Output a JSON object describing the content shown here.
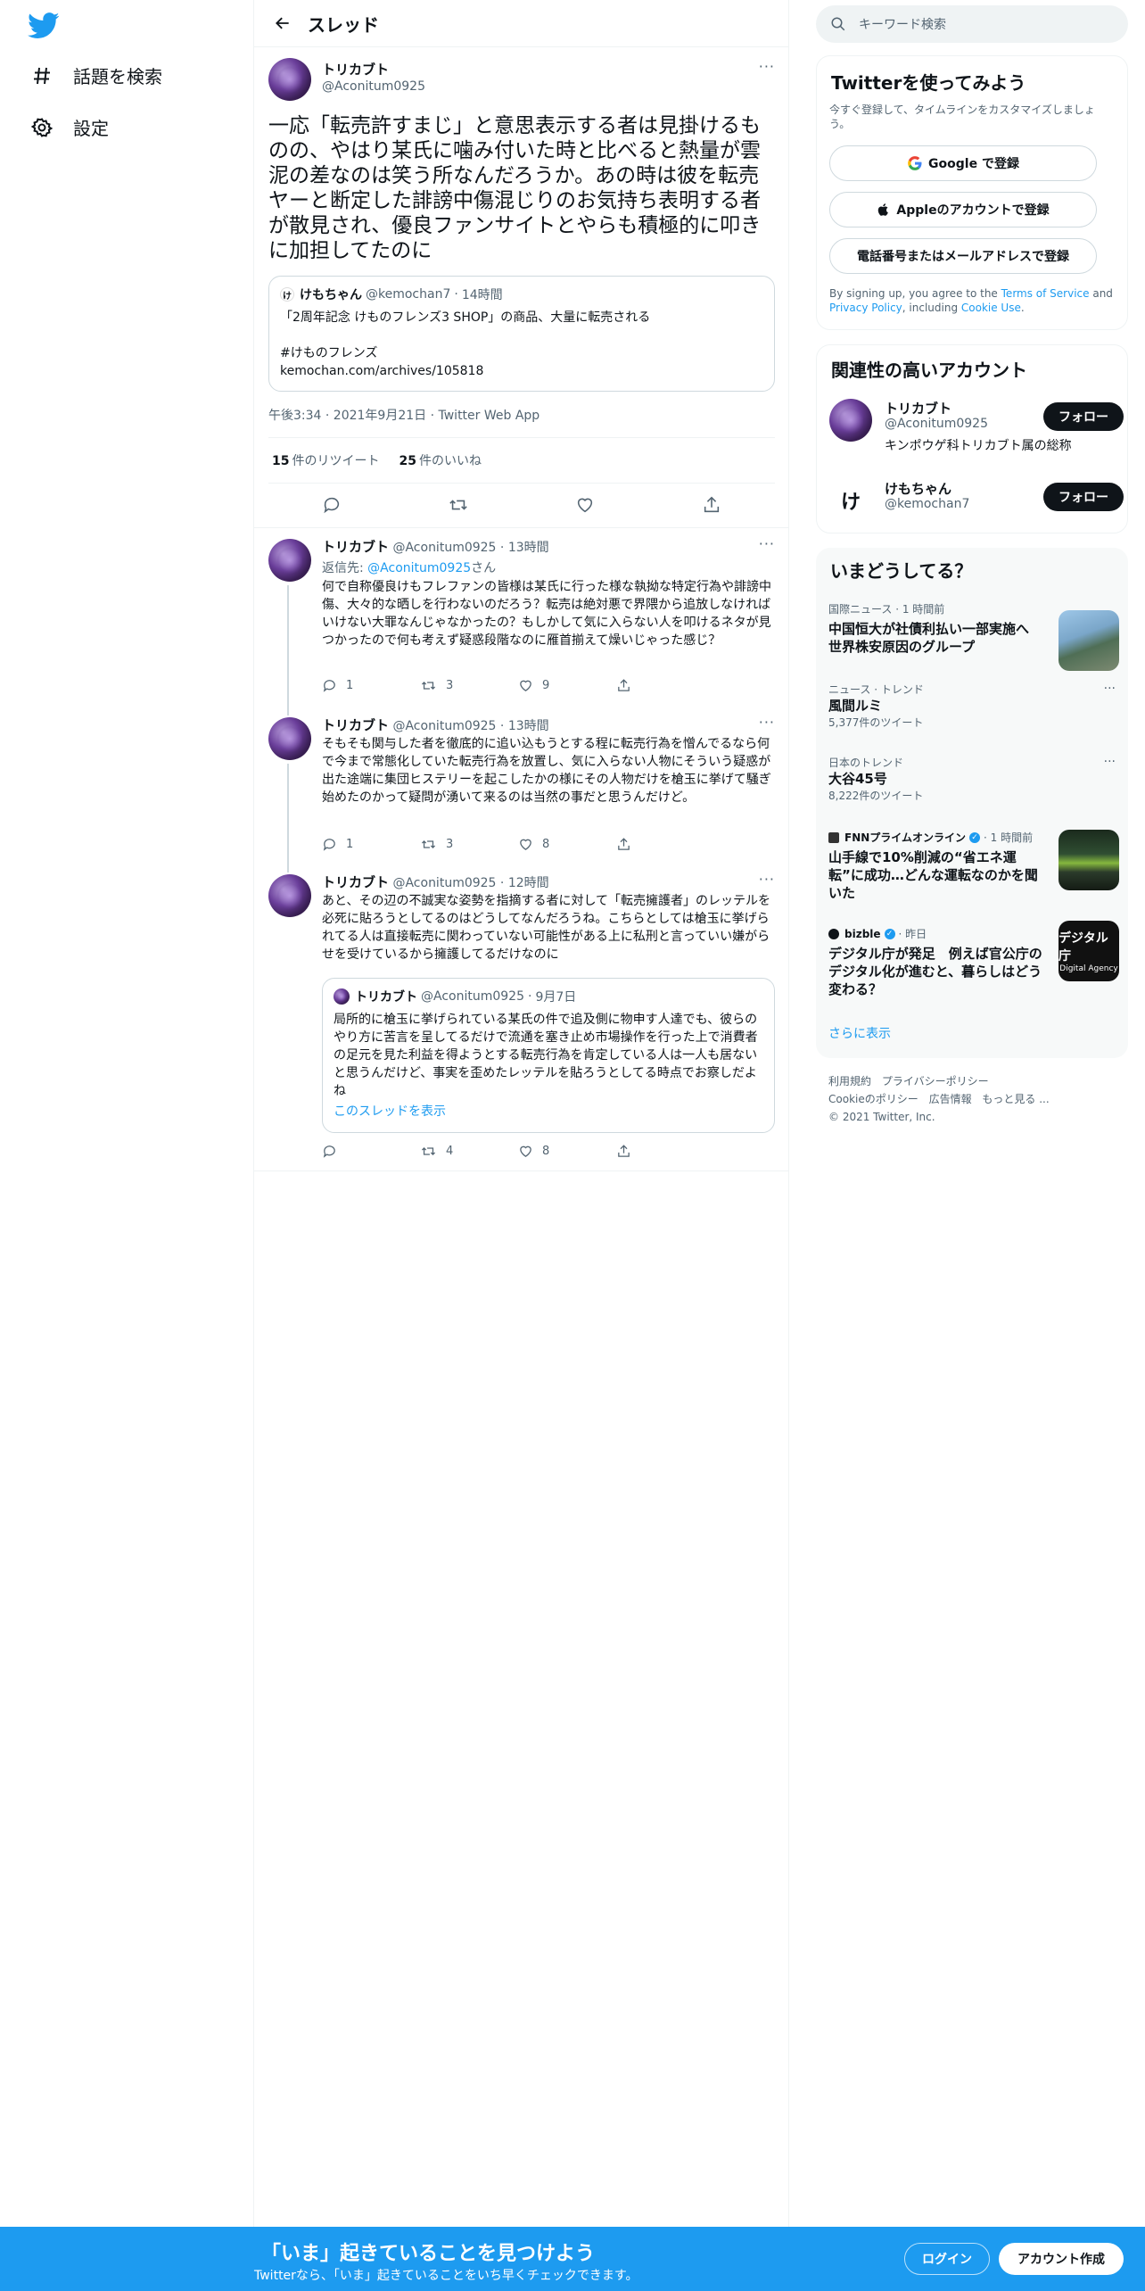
{
  "nav": {
    "explore_label": "話題を検索",
    "settings_label": "設定"
  },
  "header": {
    "title": "スレッド"
  },
  "main_tweet": {
    "author_name": "トリカブト",
    "author_handle": "@Aconitum0925",
    "more": "···",
    "text": "一応「転売許すまじ」と意思表示する者は見掛けるものの、やはり某氏に噛み付いた時と比べると熱量が雲泥の差なのは笑う所なんだろうか。あの時は彼を転売ヤーと断定した誹謗中傷混じりのお気持ち表明する者が散見され、優良ファンサイトとやらも積極的に叩きに加担してたのに",
    "quote": {
      "avatar_letter": "け",
      "name": "けもちゃん",
      "handle": "@kemochan7",
      "time": "14時間",
      "text": "「2周年記念 けものフレンズ3 SHOP」の商品、大量に転売される\n\n#けものフレンズ\nkemochan.com/archives/105818"
    },
    "timestamp": "午後3:34 · 2021年9月21日 · Twitter Web App",
    "retweets_count": "15",
    "retweets_label": "件のリツイート",
    "likes_count": "25",
    "likes_label": "件のいいね"
  },
  "replies": [
    {
      "name": "トリカブト",
      "handle": "@Aconitum0925",
      "time": "13時間",
      "reply_to_prefix": "返信先: ",
      "reply_to_handle": "@Aconitum0925",
      "reply_to_suffix": "さん",
      "text": "何で自称優良けもフレファンの皆様は某氏に行った様な執拗な特定行為や誹謗中傷、大々的な晒しを行わないのだろう？転売は絶対悪で界隈から追放しなければいけない大罪なんじゃなかったの？もしかして気に入らない人を叩けるネタが見つかったので何も考えず疑惑段階なのに雁首揃えて燥いじゃった感じ？",
      "replies": "1",
      "retweets": "3",
      "likes": "9"
    },
    {
      "name": "トリカブト",
      "handle": "@Aconitum0925",
      "time": "13時間",
      "text": "そもそも関与した者を徹底的に追い込もうとする程に転売行為を憎んでるなら何で今まで常態化していた転売行為を放置し、気に入らない人物にそういう疑惑が出た途端に集団ヒステリーを起こしたかの様にその人物だけを槍玉に挙げて騒ぎ始めたのかって疑問が湧いて来るのは当然の事だと思うんだけど。",
      "replies": "1",
      "retweets": "3",
      "likes": "8"
    },
    {
      "name": "トリカブト",
      "handle": "@Aconitum0925",
      "time": "12時間",
      "text": "あと、その辺の不誠実な姿勢を指摘する者に対して「転売擁護者」のレッテルを必死に貼ろうとしてるのはどうしてなんだろうね。こちらとしては槍玉に挙げられてる人は直接転売に関わっていない可能性がある上に私刑と言っていい嫌がらせを受けているから擁護してるだけなのに",
      "quote": {
        "name": "トリカブト",
        "handle": "@Aconitum0925",
        "time": "9月7日",
        "text": "局所的に槍玉に挙げられている某氏の件で追及側に物申す人達でも、彼らのやり方に苦言を呈してるだけで流通を塞き止め市場操作を行った上で消費者の足元を見た利益を得ようとする転売行為を肯定している人は一人も居ないと思うんだけど、事実を歪めたレッテルを貼ろうとしてる時点でお察しだよね",
        "show_thread": "このスレッドを表示"
      },
      "replies": "",
      "retweets": "4",
      "likes": "8"
    }
  ],
  "right": {
    "search_placeholder": "キーワード検索",
    "signup": {
      "title": "Twitterを使ってみよう",
      "subtitle": "今すぐ登録して、タイムラインをカスタマイズしましょう。",
      "google_label": "Google で登録",
      "apple_label": "Appleのアカウントで登録",
      "phone_label": "電話番号またはメールアドレスで登録",
      "terms_prefix": "By signing up, you agree to the ",
      "terms_link": "Terms of Service",
      "terms_and": " and ",
      "privacy_link": "Privacy Policy",
      "terms_including": ", including ",
      "cookie_link": "Cookie Use",
      "terms_end": "."
    },
    "relevant": {
      "title": "関連性の高いアカウント",
      "accounts": [
        {
          "name": "トリカブト",
          "handle": "@Aconitum0925",
          "bio": "キンポウゲ科トリカブト属の総称",
          "follow_label": "フォロー"
        },
        {
          "name": "けもちゃん",
          "handle": "@kemochan7",
          "bio": "",
          "avatar_letter": "け",
          "follow_label": "フォロー"
        }
      ]
    },
    "trends": {
      "title": "いまどうしてる？",
      "items": [
        {
          "context": "国際ニュース · 1 時間前",
          "title": "中国恒大が社債利払い一部実施へ 世界株安原因のグループ",
          "count": ""
        },
        {
          "context": "ニュース · トレンド",
          "title": "風間ルミ",
          "count": "5,377件のツイート"
        },
        {
          "context": "日本のトレンド",
          "title": "大谷45号",
          "count": "8,222件のツイート"
        },
        {
          "source": "FNNプライムオンライン",
          "time": "· 1 時間前",
          "title": "山手線で10%削減の“省エネ運転”に成功…どんな運転なのかを聞いた",
          "count": ""
        },
        {
          "source": "bizble",
          "time": "· 昨日",
          "title": "デジタル庁が発足　例えば官公庁のデジタル化が進むと、暮らしはどう変わる？",
          "count": "",
          "thumb_text_1": "デジタル庁",
          "thumb_text_2": "Digital Agency"
        }
      ],
      "show_more": "さらに表示",
      "more_dots": "···"
    },
    "footer": {
      "line1_a": "利用規約",
      "line1_b": "プライバシーポリシー",
      "line2_a": "Cookieのポリシー",
      "line2_b": "広告情報",
      "line2_c": "もっと見る ...",
      "copyright": "© 2021 Twitter, Inc."
    }
  },
  "bottom": {
    "headline": "「いま」起きていることを見つけよう",
    "sub": "Twitterなら、「いま」起きていることをいち早くチェックできます。",
    "login_label": "ログイン",
    "signup_label": "アカウント作成"
  },
  "colors": {
    "twitter_blue": "#1d9bf0",
    "text": "#0f1419",
    "muted": "#536471",
    "border": "#eff3f4"
  }
}
